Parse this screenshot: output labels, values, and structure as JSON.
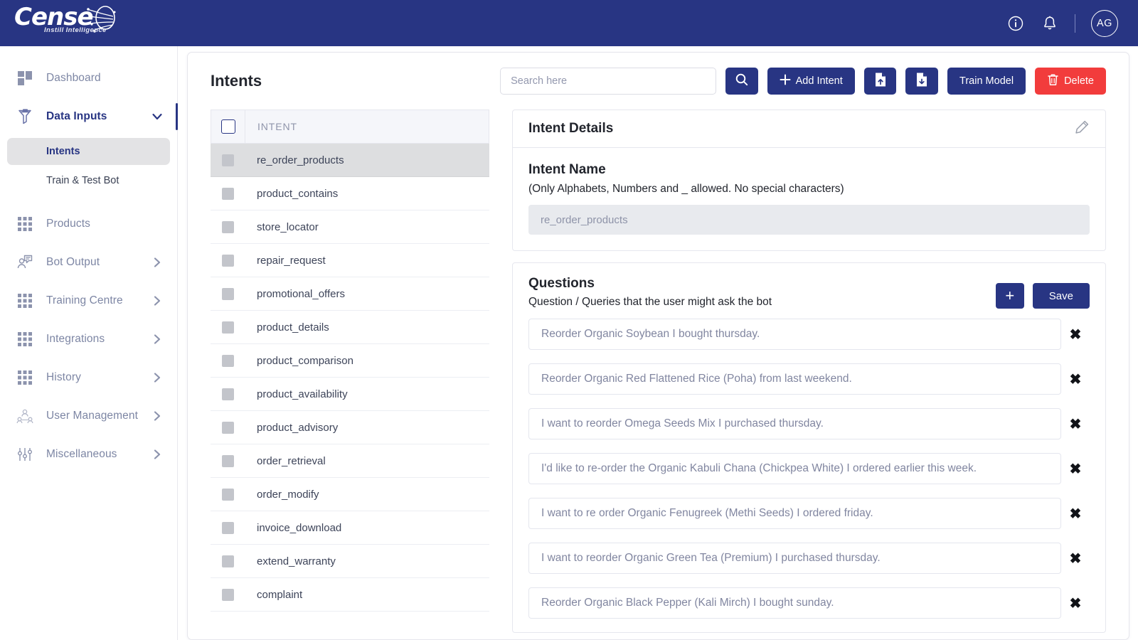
{
  "brand": {
    "name": "Cense",
    "tagline": "Instill Intelligence",
    "header_color": "#283583",
    "accent_color": "#283583",
    "danger_color": "#f23c3c"
  },
  "topbar": {
    "info_icon": "info-circle-icon",
    "bell_icon": "bell-icon",
    "avatar_initials": "AG"
  },
  "sidebar": {
    "items": [
      {
        "label": "Dashboard",
        "icon": "dashboard-grid-icon",
        "chevron": "",
        "active": false
      },
      {
        "label": "Data Inputs",
        "icon": "funnel-filter-icon",
        "chevron": "down",
        "active": true
      },
      {
        "label": "Products",
        "icon": "apps-grid-icon",
        "chevron": "",
        "active": false
      },
      {
        "label": "Bot Output",
        "icon": "user-chat-icon",
        "chevron": "right",
        "active": false
      },
      {
        "label": "Training Centre",
        "icon": "apps-grid-icon",
        "chevron": "right",
        "active": false
      },
      {
        "label": "Integrations",
        "icon": "apps-grid-icon",
        "chevron": "right",
        "active": false
      },
      {
        "label": "History",
        "icon": "apps-grid-icon",
        "chevron": "right",
        "active": false
      },
      {
        "label": "User Management",
        "icon": "users-group-icon",
        "chevron": "right",
        "active": false
      },
      {
        "label": "Miscellaneous",
        "icon": "sliders-icon",
        "chevron": "right",
        "active": false
      }
    ],
    "sub_items": [
      {
        "label": "Intents",
        "selected": true
      },
      {
        "label": "Train & Test Bot",
        "selected": false
      }
    ]
  },
  "toolbar": {
    "page_title": "Intents",
    "search_placeholder": "Search here",
    "search_value": "",
    "search_button_icon": "search-icon",
    "add_intent_label": "Add Intent",
    "upload_icon": "file-upload-icon",
    "download_icon": "file-download-icon",
    "train_model_label": "Train Model",
    "delete_label": "Delete",
    "delete_icon": "trash-icon"
  },
  "intent_table": {
    "select_all_checkbox": false,
    "column_header": "INTENT",
    "rows": [
      {
        "name": "re_order_products",
        "selected": true
      },
      {
        "name": "product_contains",
        "selected": false
      },
      {
        "name": "store_locator",
        "selected": false
      },
      {
        "name": "repair_request",
        "selected": false
      },
      {
        "name": "promotional_offers",
        "selected": false
      },
      {
        "name": "product_details",
        "selected": false
      },
      {
        "name": "product_comparison",
        "selected": false
      },
      {
        "name": "product_availability",
        "selected": false
      },
      {
        "name": "product_advisory",
        "selected": false
      },
      {
        "name": "order_retrieval",
        "selected": false
      },
      {
        "name": "order_modify",
        "selected": false
      },
      {
        "name": "invoice_download",
        "selected": false
      },
      {
        "name": "extend_warranty",
        "selected": false
      },
      {
        "name": "complaint",
        "selected": false
      }
    ]
  },
  "intent_details": {
    "panel_title": "Intent Details",
    "edit_icon": "pencil-edit-icon",
    "intent_name_label": "Intent Name",
    "intent_name_hint": "(Only Alphabets, Numbers and _ allowed. No special characters)",
    "intent_name_value": "re_order_products"
  },
  "questions": {
    "title": "Questions",
    "subtitle": "Question / Queries that the user might ask the bot",
    "add_label": "+",
    "save_label": "Save",
    "delete_icon": "close-x-icon",
    "items": [
      "Reorder Organic Soybean I bought thursday.",
      "Reorder Organic Red Flattened Rice (Poha) from last weekend.",
      "I want to reorder Omega Seeds Mix I purchased thursday.",
      "I'd like to re-order the Organic Kabuli Chana (Chickpea White) I ordered earlier this week.",
      "I want to re order Organic Fenugreek (Methi Seeds) I ordered friday.",
      "I want to reorder Organic Green Tea (Premium) I purchased thursday.",
      "Reorder Organic Black Pepper (Kali Mirch) I bought sunday."
    ]
  }
}
